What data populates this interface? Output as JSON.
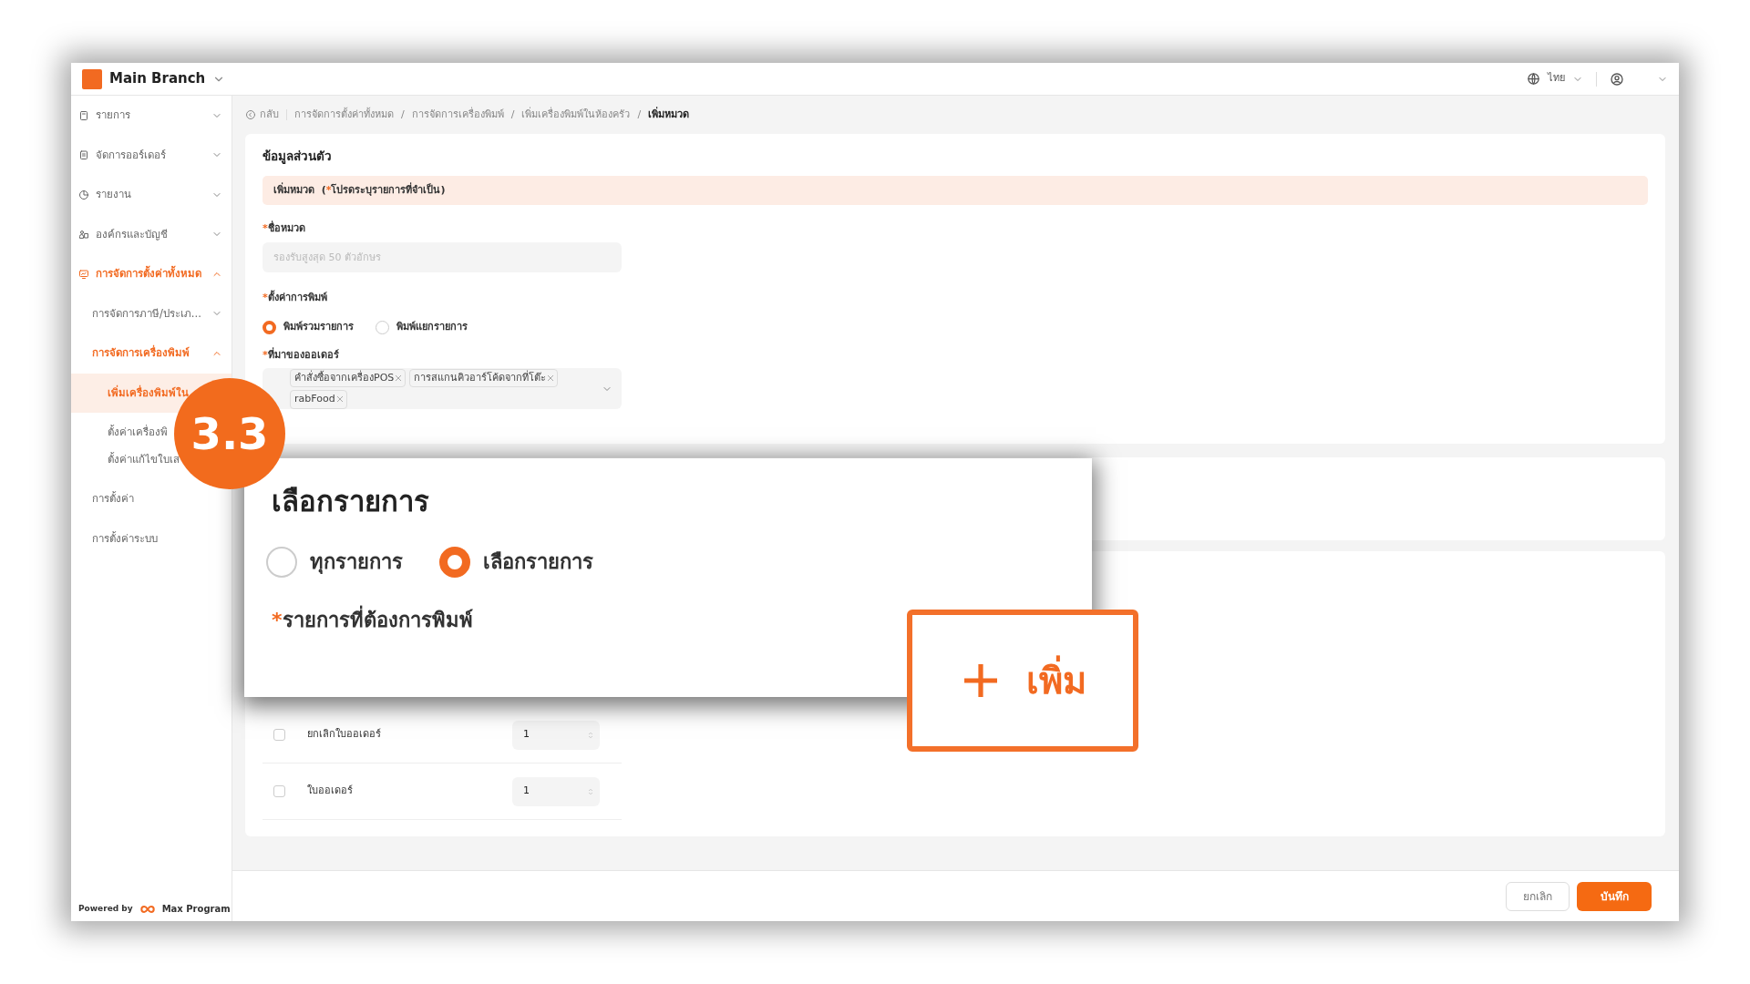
{
  "header": {
    "branch": "Main Branch",
    "language": "ไทย"
  },
  "sidebar": {
    "items": [
      {
        "label": "รายการ",
        "expanded": false,
        "active": false
      },
      {
        "label": "จัดการออร์เดอร์",
        "expanded": false,
        "active": false
      },
      {
        "label": "รายงาน",
        "expanded": false,
        "active": false
      },
      {
        "label": "องค์กรและบัญชี",
        "expanded": false,
        "active": false
      },
      {
        "label": "การจัดการตั้งค่าทั้งหมด",
        "expanded": true,
        "active": true,
        "children": [
          {
            "label": "การจัดการภาษี/ประเภ...",
            "expanded": false,
            "active": false
          },
          {
            "label": "การจัดการเครื่องพิมพ์",
            "expanded": true,
            "active": true,
            "children": [
              {
                "label": "เพิ่มเครื่องพิมพ์ใน",
                "selected": true
              },
              {
                "label": "ตั้งค่าเครื่องพิ",
                "selected": false
              },
              {
                "label": "ตั้งค่าแก้ไขใบเส",
                "selected": false
              }
            ]
          },
          {
            "label": "การตั้งค่า",
            "active": false
          },
          {
            "label": "การตั้งค่าระบบ",
            "active": false
          }
        ]
      }
    ],
    "powered_by": "Powered by",
    "brand": "Max Program"
  },
  "breadcrumb": {
    "back": "กลับ",
    "items": [
      {
        "label": "การจัดการตั้งค่าทั้งหมด"
      },
      {
        "separator": "/",
        "label": "การจัดการเครื่องพิมพ์"
      },
      {
        "separator": "/",
        "label": "เพิ่มเครื่องพิมพ์ในห้องครัว"
      },
      {
        "separator": "/",
        "label": "เพิ่มหมวด"
      }
    ]
  },
  "form": {
    "title": "ข้อมูลส่วนตัว",
    "banner": {
      "title": "เพิ่มหมวด",
      "note_open": "(",
      "note_mark": "*",
      "note_text": "โปรดระบุรายการที่จำเป็น)"
    },
    "name_field": {
      "required_mark": "*",
      "label": "ชื่อหมวด",
      "placeholder": "รองรับสูงสุด 50 ตัวอักษร"
    },
    "print_setting": {
      "required_mark": "*",
      "label": "ตั้งค่าการพิมพ์",
      "options": [
        {
          "label": "พิมพ์รวมรายการ",
          "selected": true
        },
        {
          "label": "พิมพ์แยกรายการ",
          "selected": false
        }
      ]
    },
    "order_source": {
      "required_mark": "*",
      "label": "ที่มาของออเดอร์",
      "tags": [
        "คำสั่งซื้อจากเครื่องPOS",
        "การสแกนคิวอาร์โค้ดจากที่โต๊ะ",
        "rabFood"
      ]
    },
    "documents": [
      {
        "label": "ยกเลิกใบออเดอร์",
        "checked": false,
        "quantity": "1"
      },
      {
        "label": "ใบออเดอร์",
        "checked": false,
        "quantity": "1"
      }
    ]
  },
  "footer": {
    "cancel": "ยกเลิก",
    "save": "บันทึก"
  },
  "zoom_panel": {
    "title": "เลือกรายการ",
    "options": [
      {
        "label": "ทุกรายการ",
        "selected": false
      },
      {
        "label": "เลือกรายการ",
        "selected": true
      }
    ],
    "required_mark": "*",
    "field_label": "รายการที่ต้องการพิมพ์"
  },
  "callout": {
    "label": "เพิ่ม"
  },
  "step_badge": "3.3"
}
